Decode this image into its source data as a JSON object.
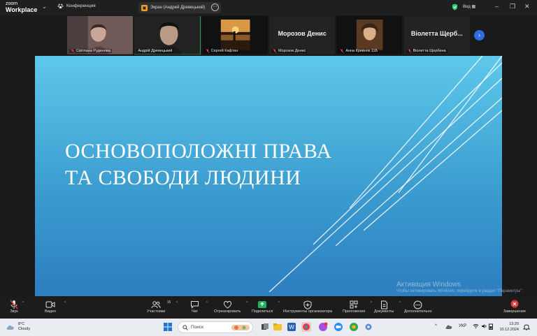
{
  "titlebar": {
    "logo_line1": "zoom",
    "logo_line2": "Workplace",
    "conference_label": "Конференция",
    "screen_share_label": "Экран (Андрей Древецький)",
    "view_label": "Вид"
  },
  "participants": [
    {
      "name": "Світлана Руденова",
      "video": true,
      "active": false
    },
    {
      "name": "Андрій Древецький",
      "video": true,
      "active": true
    },
    {
      "name": "Сергей Кафтан",
      "video": true,
      "active": false
    },
    {
      "name": "Морозов Денис",
      "display_name": "Морозов Денис",
      "video": false,
      "active": false
    },
    {
      "name": "Анна Кривняк 11Б",
      "video": true,
      "active": false
    },
    {
      "name": "Віолетта Щербина",
      "display_name": "Віолетта Щерб...",
      "video": false,
      "active": false
    }
  ],
  "slide": {
    "title_line1": "ОСНОВОПОЛОЖНІ ПРАВА",
    "title_line2": "ТА СВОБОДИ ЛЮДИНИ"
  },
  "activation": {
    "title": "Активация Windows",
    "subtitle": "Чтобы активировать Windows, перейдите в раздел \"Параметры\"."
  },
  "toolbar": {
    "audio_label": "Звук",
    "video_label": "Видео",
    "participants_label": "Участники",
    "participants_count": "15",
    "chat_label": "Чат",
    "react_label": "Отреагировать",
    "share_label": "Поделиться",
    "host_tools_label": "Инструменты организатора",
    "apps_label": "Приложения",
    "docs_label": "Документы",
    "more_label": "Дополнительно",
    "end_label": "Завершение"
  },
  "taskbar": {
    "temperature": "8°C",
    "weather_text": "Cloudy",
    "search_placeholder": "Поиск",
    "language": "УКР",
    "time": "13:20",
    "date": "10.12.2024"
  },
  "colors": {
    "accent_green": "#2ecc71",
    "next_button_blue": "#2d6fe0",
    "end_red": "#e03a3a",
    "share_green": "#1fb35a"
  }
}
